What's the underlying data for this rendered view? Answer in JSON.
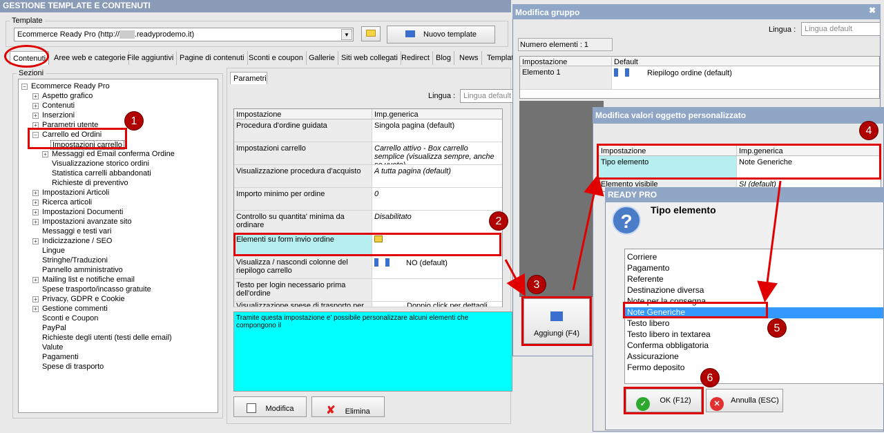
{
  "main": {
    "title": "GESTIONE TEMPLATE E CONTENUTI",
    "template_label": "Template",
    "template_value": "Ecommerce Ready Pro (http://",
    "template_value_suffix": ".readyprodemo.it)",
    "new_template_label": "Nuovo template",
    "tabs": [
      "Contenuti",
      "Aree web e categorie",
      "File aggiuntivi",
      "Pagine di contenuti",
      "Sconti e coupon",
      "Gallerie",
      "Siti web collegati",
      "Redirect",
      "Blog",
      "News",
      "Templat"
    ],
    "sections_label": "Sezioni",
    "tree": [
      "Ecommerce Ready Pro",
      "Aspetto grafico",
      "Contenuti",
      "Inserzioni",
      "Parametri utente",
      "Carrello ed Ordini",
      "Impostazioni carrello",
      "Messaggi ed Email conferma Ordine",
      "Visualizzazione storico ordini",
      "Statistica carrelli abbandonati",
      "Richieste di preventivo",
      "Impostazioni Articoli",
      "Ricerca articoli",
      "Impostazioni Documenti",
      "Impostazioni avanzate sito",
      "Messaggi e testi vari",
      "Indicizzazione / SEO",
      "Lingue",
      "Stringhe/Traduzioni",
      "Pannello amministrativo",
      "Mailing list e notifiche email",
      "Spese trasporto/incasso gratuite",
      "Privacy, GDPR e Cookie",
      "Gestione commenti",
      "Sconti e Coupon",
      "PayPal",
      "Richieste degli utenti (testi delle email)",
      "Valute",
      "Pagamenti",
      "Spese di trasporto"
    ],
    "params_tab": "Parametri",
    "lingua_label": "Lingua :",
    "lingua_placeholder": "Lingua default",
    "grid_headers": [
      "Impostazione",
      "Imp.generica"
    ],
    "grid_rows": [
      [
        "Procedura d'ordine guidata",
        "Singola pagina (default)"
      ],
      [
        "Impostazioni carrello",
        "Carrello attivo - Box carrello semplice (visualizza sempre, anche se vuoto)"
      ],
      [
        "Visualizzazione procedura d'acquisto",
        "A tutta pagina (default)"
      ],
      [
        "Importo minimo per ordine",
        "0"
      ],
      [
        "Controllo su quantita' minima da ordinare",
        "Disabilitato"
      ],
      [
        "Elementi su form invio ordine",
        ""
      ],
      [
        "Visualizza / nascondi colonne del riepilogo carrello",
        "NO (default)"
      ],
      [
        "Testo per login necessario prima dell'ordine",
        ""
      ],
      [
        "Visualizzazione spese di trasporto per",
        "Doppio click per dettagli"
      ]
    ],
    "description": "Tramite questa impostazione e' possibile personalizzare alcuni elementi che compongono il",
    "modifica_label": "Modifica",
    "elimina_label": "Elimina"
  },
  "group_dialog": {
    "title": "Modifica gruppo",
    "lingua_label": "Lingua :",
    "lingua_placeholder": "Lingua default",
    "count_label": "Numero elementi : 1",
    "headers": [
      "Impostazione",
      "Default"
    ],
    "row_name": "Elemento 1",
    "row_value": "Riepilogo ordine (default)",
    "add_label": "Aggiungi (F4)"
  },
  "custom_dialog": {
    "title": "Modifica valori oggetto personalizzato",
    "headers": [
      "Impostazione",
      "Imp.generica"
    ],
    "row_name": "Tipo elemento",
    "row_value": "Note Generiche",
    "row2_name": "Elemento visibile",
    "row2_value": "SI (default)"
  },
  "ready_dialog": {
    "title": "READY PRO",
    "heading": "Tipo elemento",
    "options": [
      "Corriere",
      "Pagamento",
      "Referente",
      "Destinazione diversa",
      "Note per la consegna",
      "Note Generiche",
      "Testo libero",
      "Testo libero in textarea",
      "Conferma obbligatoria",
      "Assicurazione",
      "Fermo deposito"
    ],
    "selected": "Note Generiche",
    "ok_label": "OK (F12)",
    "cancel_label": "Annulla (ESC)"
  },
  "badges": [
    "1",
    "2",
    "3",
    "4",
    "5",
    "6"
  ],
  "colors": {
    "title_bar": "#8a9bb8",
    "highlight": "#b7eef0",
    "selection": "#3399ff",
    "annotation": "#e00000",
    "description_bg": "#00ffff"
  }
}
